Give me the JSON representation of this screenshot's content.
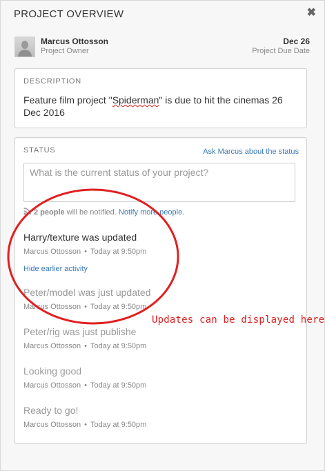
{
  "header": {
    "title": "PROJECT OVERVIEW",
    "close_glyph": "✖"
  },
  "owner": {
    "name": "Marcus Ottosson",
    "role": "Project Owner",
    "due_date": "Dec 26",
    "due_label": "Project Due Date"
  },
  "description": {
    "label": "DESCRIPTION",
    "text_before": "Feature film project \"",
    "text_misspelled": "Spiderman",
    "text_after": "\" is due to hit the cinemas 26 Dec 2016"
  },
  "status": {
    "label": "STATUS",
    "ask_link": "Ask Marcus about the status",
    "input_placeholder": "What is the current status of your project?",
    "notify_count": "2 people",
    "notify_text": " will be notified. ",
    "notify_link": "Notify more people.",
    "hide_link": "Hide earlier activity",
    "activities": [
      {
        "title": "Harry/texture was updated",
        "author": "Marcus Ottosson",
        "time": "Today at 9:50pm",
        "muted": false
      },
      {
        "title": "Peter/model was just updated",
        "author": "Marcus Ottosson",
        "time": "Today at 9:50pm",
        "muted": true
      },
      {
        "title": "Peter/rig was just publishe",
        "author": "Marcus Ottosson",
        "time": "Today at 9:50pm",
        "muted": true
      },
      {
        "title": "Looking good",
        "author": "Marcus Ottosson",
        "time": "Today at 9:50pm",
        "muted": true
      },
      {
        "title": "Ready to go!",
        "author": "Marcus Ottosson",
        "time": "Today at 9:50pm",
        "muted": true
      }
    ],
    "meta_separator": "•"
  },
  "annotation": {
    "text": "Updates can be displayed here",
    "color": "#e02020"
  },
  "colors": {
    "link": "#3b7ab7",
    "annotation": "#e02020"
  },
  "icons": {
    "close": "close-icon",
    "rss": "rss-icon",
    "avatar": "avatar"
  }
}
